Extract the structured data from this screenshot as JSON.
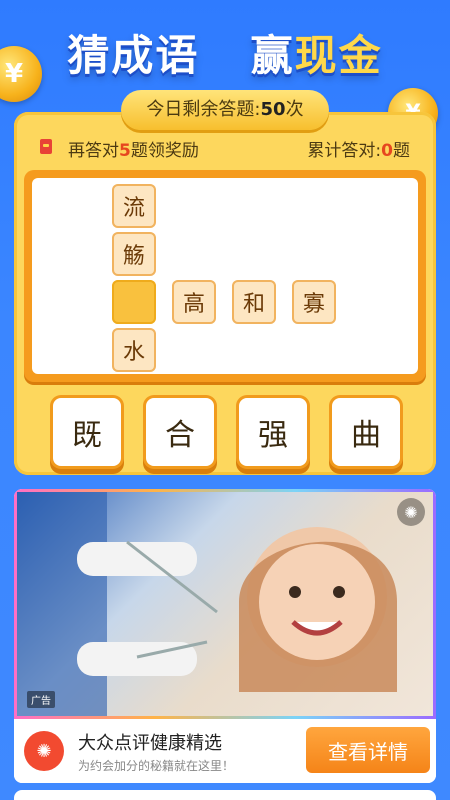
{
  "header": {
    "title_part1": "猜成语",
    "title_part2": "赢",
    "title_part3": "现金"
  },
  "coins": {
    "symbol": "¥"
  },
  "status": {
    "remaining_label": "今日剩余答题:",
    "remaining_count": "50",
    "remaining_unit": "次",
    "reward_prefix": "再答对",
    "reward_count": "5",
    "reward_suffix": "题领奖励",
    "total_label": "累计答对:",
    "total_count": "0",
    "total_unit": "题"
  },
  "board": {
    "cells": [
      "流",
      "觞",
      "",
      "水",
      "高",
      "和",
      "寡"
    ]
  },
  "choices": [
    "既",
    "合",
    "强",
    "曲"
  ],
  "ad": {
    "tag": "广告",
    "title": "大众点评健康精选",
    "subtitle": "为约会加分的秘籍就在这里！",
    "button": "查看详情",
    "logo_icon": "dianping-logo-icon"
  },
  "colors": {
    "accent_orange": "#f59b1e",
    "panel_yellow": "#fdd75d",
    "bg_blue": "#3b86ff"
  }
}
